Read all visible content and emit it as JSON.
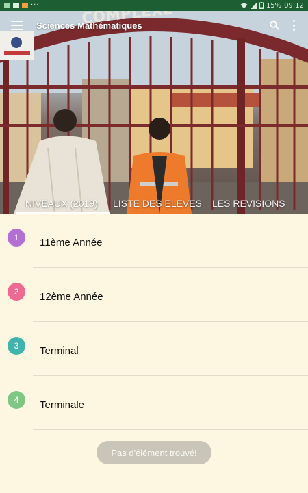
{
  "status_bar": {
    "battery": "15%",
    "time": "09:12",
    "dots": "···",
    "icons": [
      "notification-icon",
      "image-icon",
      "mail-icon",
      "wifi-icon",
      "signal-icon",
      "battery-icon"
    ]
  },
  "app_bar": {
    "title": "Sciences Mathématiques",
    "icons": [
      "menu-icon",
      "search-icon",
      "more-vert-icon"
    ]
  },
  "hero": {
    "banner_text": "COMPLEXE"
  },
  "tabs": [
    {
      "label": "NIVEAUX (2019)",
      "active": true
    },
    {
      "label": "LISTE DES ELEVES",
      "active": false
    },
    {
      "label": "LES REVISIONS",
      "active": false
    }
  ],
  "levels": [
    {
      "number": "1",
      "label": "11ème Année",
      "color": "#b36fd1"
    },
    {
      "number": "2",
      "label": "12ème Année",
      "color": "#ee6a93"
    },
    {
      "number": "3",
      "label": "Terminal",
      "color": "#41b3ad"
    },
    {
      "number": "4",
      "label": "Terminale",
      "color": "#80c784"
    }
  ],
  "toast": "Pas d'élément trouvé!",
  "colors": {
    "status_bar": "#1e5e33",
    "background": "#fdf6e0",
    "divider": "#e2dccb",
    "toast_bg": "#c9c5b8"
  }
}
